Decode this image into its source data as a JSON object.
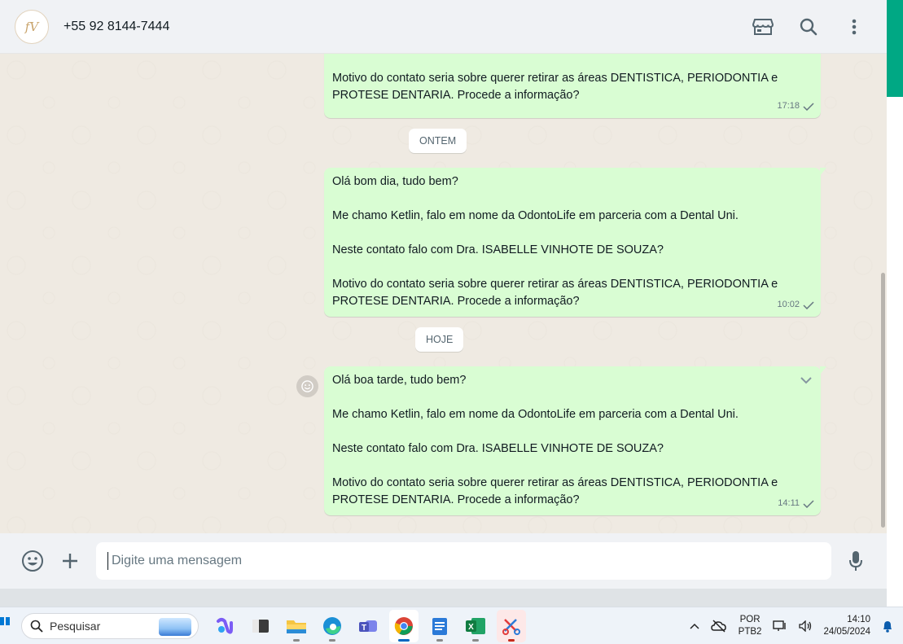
{
  "header": {
    "contact_name": "+55 92 8144-7444",
    "avatar_text": "fV",
    "icons": [
      "catalog-store-icon",
      "search-icon",
      "menu-dots-icon"
    ]
  },
  "messages": [
    {
      "text": "Neste contato falo com Dra. ISABELLE VINHOTE DE SOUZA?\n\nMotivo do contato seria sobre querer retirar as áreas DENTISTICA, PERIODONTIA e PROTESE DENTARIA. Procede a informação?",
      "time": "17:18"
    },
    {
      "text": "Olá bom dia, tudo bem?\n\nMe chamo Ketlin, falo em nome da OdontoLife em parceria com a Dental Uni.\n\nNeste contato falo com Dra. ISABELLE VINHOTE DE SOUZA?\n\nMotivo do contato seria sobre querer retirar as áreas DENTISTICA, PERIODONTIA e PROTESE DENTARIA. Procede a informação?",
      "time": "10:02"
    },
    {
      "text": "Olá boa tarde, tudo bem?\n\nMe chamo Ketlin, falo em nome da OdontoLife em parceria com a Dental Uni.\n\nNeste contato falo com Dra. ISABELLE VINHOTE DE SOUZA?\n\nMotivo do contato seria sobre querer retirar as áreas DENTISTICA, PERIODONTIA e PROTESE DENTARIA. Procede a informação?",
      "time": "14:11"
    }
  ],
  "date_labels": {
    "yesterday": "ONTEM",
    "today": "HOJE"
  },
  "composer": {
    "placeholder": "Digite uma mensagem"
  },
  "taskbar": {
    "search_label": "Pesquisar",
    "apps": [
      "copilot-icon",
      "terminal-icon",
      "file-explorer-icon",
      "edge-icon",
      "teams-icon",
      "chrome-icon",
      "notepad-icon",
      "excel-icon",
      "snipping-tool-icon"
    ],
    "language_line1": "POR",
    "language_line2": "PTB2",
    "time": "14:10",
    "date": "24/05/2024"
  },
  "colors": {
    "accent": "#00a884",
    "bubble_out": "#d9fdd3",
    "chat_bg": "#efeae2"
  }
}
